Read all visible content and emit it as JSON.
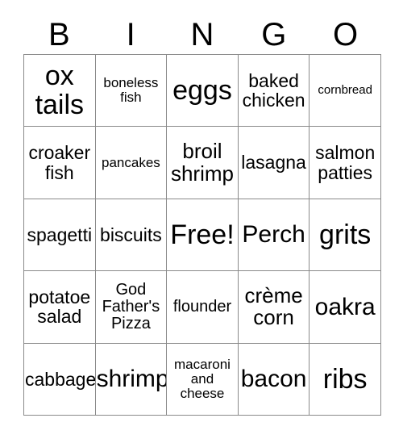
{
  "card": {
    "title": "Bingo Card",
    "header_letters": [
      "B",
      "I",
      "N",
      "G",
      "O"
    ],
    "free_space_label": "Free!",
    "colors": {
      "background": "#ffffff",
      "grid_line": "#8a8a8a",
      "text": "#000000"
    },
    "grid": {
      "columns": 5,
      "rows": 5,
      "cells": [
        [
          {
            "text": "ox\ntails",
            "size": "xxl"
          },
          {
            "text": "boneless\nfish",
            "size": "xs"
          },
          {
            "text": "eggs",
            "size": "xxl"
          },
          {
            "text": "baked\nchicken",
            "size": "md"
          },
          {
            "text": "cornbread",
            "size": "xxs"
          }
        ],
        [
          {
            "text": "croaker\nfish",
            "size": "md"
          },
          {
            "text": "pancakes",
            "size": "xs"
          },
          {
            "text": "broil\nshrimp",
            "size": "lg"
          },
          {
            "text": "lasagna",
            "size": "md"
          },
          {
            "text": "salmon\npatties",
            "size": "md"
          }
        ],
        [
          {
            "text": "spagetti",
            "size": "md"
          },
          {
            "text": "biscuits",
            "size": "md"
          },
          {
            "text": "Free!",
            "size": "xxl"
          },
          {
            "text": "Perch",
            "size": "xl"
          },
          {
            "text": "grits",
            "size": "xxl"
          }
        ],
        [
          {
            "text": "potatoe\nsalad",
            "size": "md"
          },
          {
            "text": "God\nFather's\nPizza",
            "size": "sm"
          },
          {
            "text": "flounder",
            "size": "sm"
          },
          {
            "text": "crème\ncorn",
            "size": "lg"
          },
          {
            "text": "oakra",
            "size": "xl"
          }
        ],
        [
          {
            "text": "cabbage",
            "size": "md"
          },
          {
            "text": "shrimp",
            "size": "xl"
          },
          {
            "text": "macaroni\nand\ncheese",
            "size": "xs"
          },
          {
            "text": "bacon",
            "size": "xl"
          },
          {
            "text": "ribs",
            "size": "xxl"
          }
        ]
      ]
    }
  }
}
